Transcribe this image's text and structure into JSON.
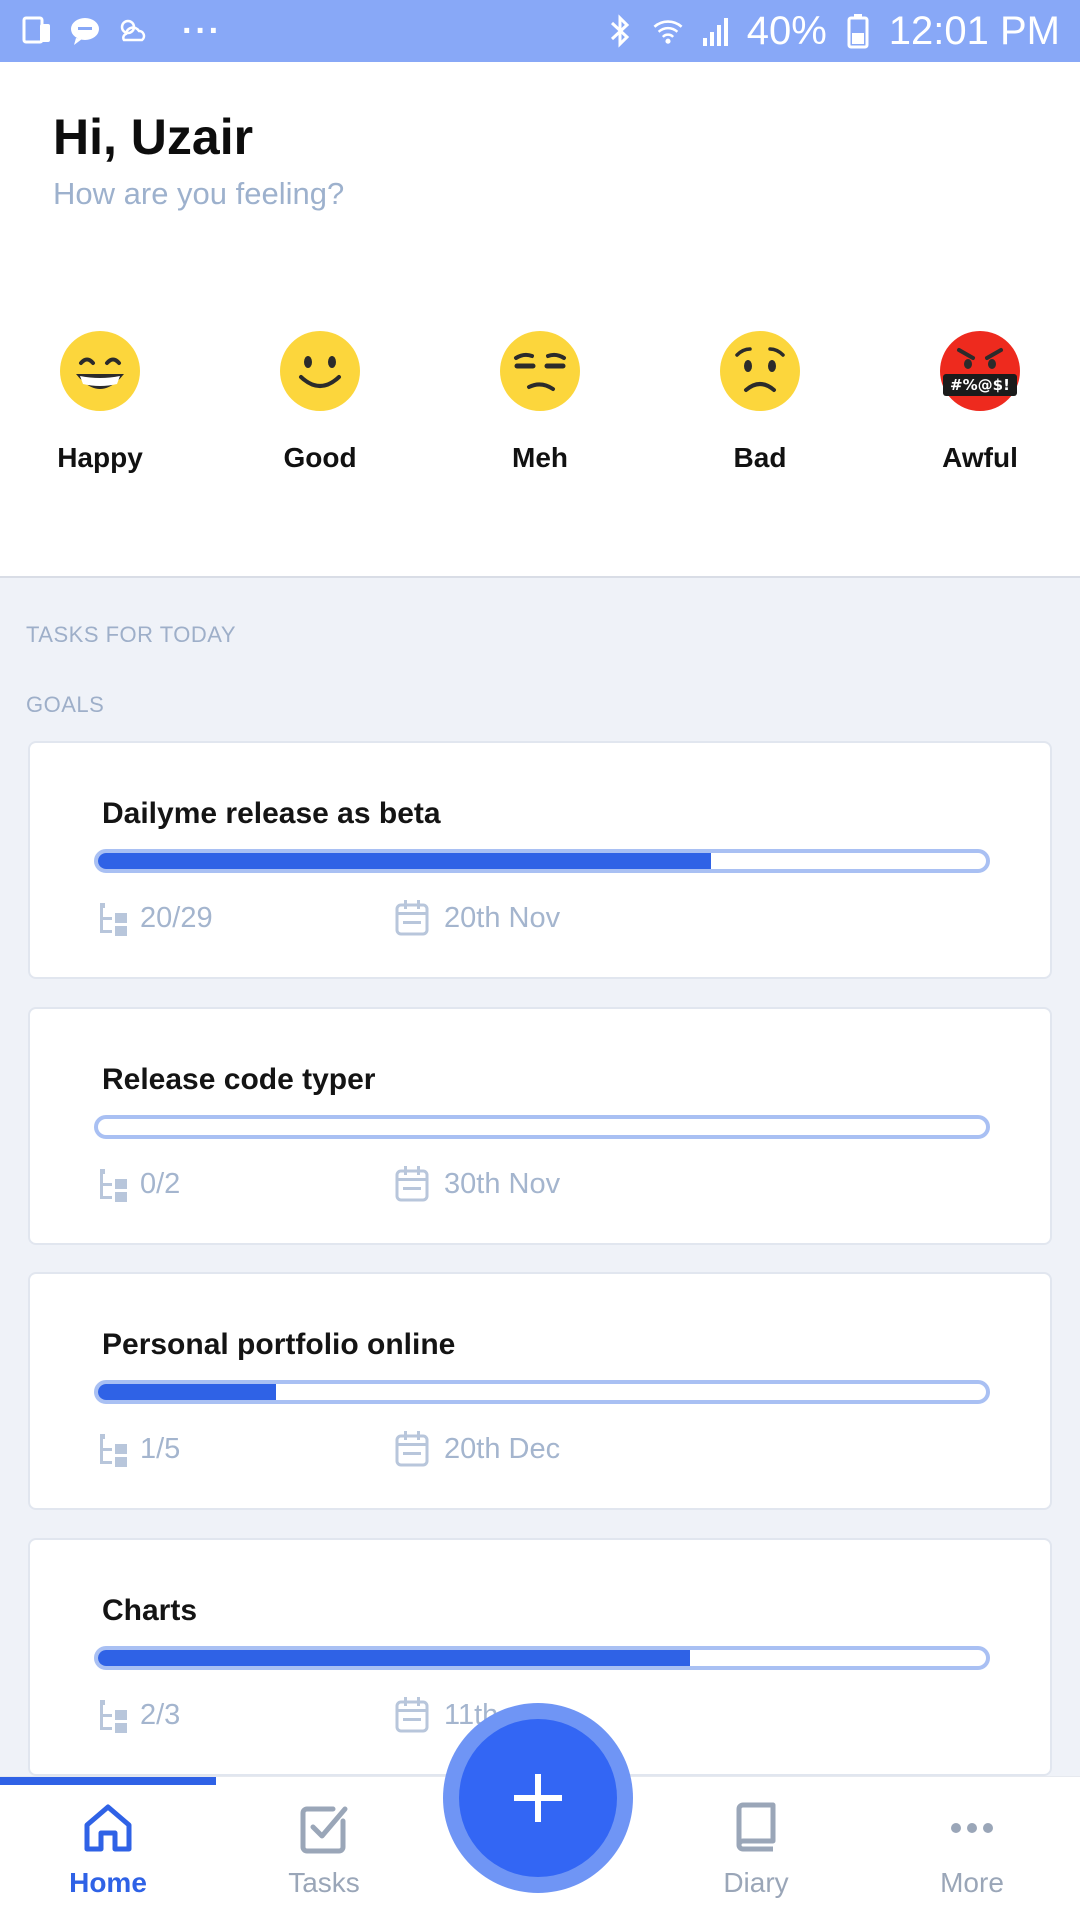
{
  "status_bar": {
    "battery": "40%",
    "time": "12:01 PM",
    "dots": "···",
    "left_icons": [
      "device-icon",
      "chat-icon",
      "weather-icon"
    ],
    "right_icons": [
      "bluetooth-icon",
      "wifi-icon",
      "signal-icon",
      "battery-icon"
    ]
  },
  "header": {
    "greeting": "Hi, Uzair",
    "subtitle": "How are you feeling?"
  },
  "moods": [
    {
      "label": "Happy",
      "icon": "grinning-face-icon"
    },
    {
      "label": "Good",
      "icon": "smiling-face-icon"
    },
    {
      "label": "Meh",
      "icon": "unamused-face-icon"
    },
    {
      "label": "Bad",
      "icon": "worried-face-icon"
    },
    {
      "label": "Awful",
      "icon": "cursing-face-icon",
      "symbols": "#%@$!"
    }
  ],
  "sections": {
    "tasks_today": "TASKS FOR TODAY",
    "goals": "GOALS"
  },
  "goals": [
    {
      "title": "Dailyme release as beta",
      "subtasks": "20/29",
      "date": "20th Nov",
      "progress": 0.69
    },
    {
      "title": "Release code typer",
      "subtasks": "0/2",
      "date": "30th Nov",
      "progress": 0.0
    },
    {
      "title": "Personal portfolio online",
      "subtasks": "1/5",
      "date": "20th Dec",
      "progress": 0.2
    },
    {
      "title": "Charts",
      "subtasks": "2/3",
      "date": "11th",
      "progress": 0.667
    }
  ],
  "bottom_nav": {
    "items": [
      {
        "label": "Home",
        "icon": "home-icon",
        "active": true
      },
      {
        "label": "Tasks",
        "icon": "tasks-checkbox-icon",
        "active": false
      },
      {
        "label": "Diary",
        "icon": "book-icon",
        "active": false
      },
      {
        "label": "More",
        "icon": "more-dots-icon",
        "active": false
      }
    ],
    "fab_icon": "plus-icon"
  },
  "colors": {
    "accent": "#2f62e6",
    "status_bar": "#88a8f7",
    "muted_text": "#9eafc9",
    "emoji_yellow": "#fcd63c",
    "emoji_red": "#ee2a1e"
  }
}
